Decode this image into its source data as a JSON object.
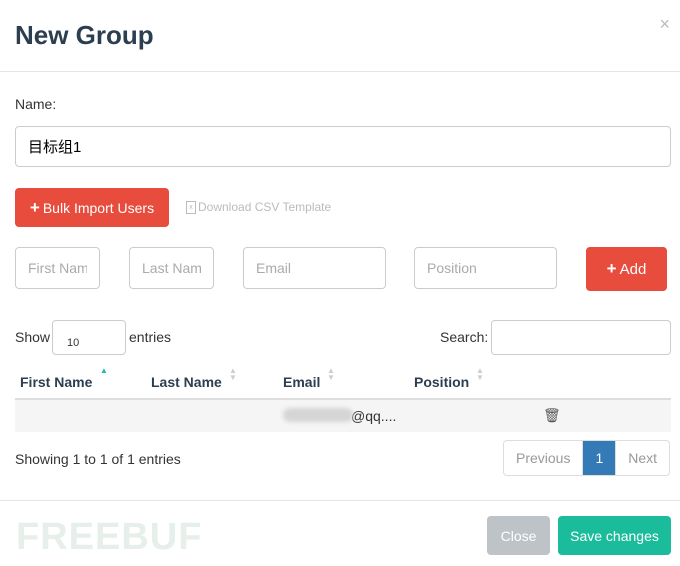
{
  "modal": {
    "title": "New Group",
    "close_icon": "×"
  },
  "form": {
    "name_label": "Name:",
    "name_value": "目标组1",
    "bulk_import": "Bulk Import Users",
    "download_csv": "Download CSV Template",
    "first_name_placeholder": "First Name",
    "last_name_placeholder": "Last Name",
    "email_placeholder": "Email",
    "position_placeholder": "Position",
    "add": "Add"
  },
  "table": {
    "show": "Show",
    "length": "10",
    "entries": "entries",
    "search_label": "Search:",
    "columns": [
      "First Name",
      "Last Name",
      "Email",
      "Position"
    ],
    "sorted_column": "First Name",
    "sort_direction": "ascending",
    "rows": [
      {
        "first_name": "",
        "last_name": "",
        "email_visible": "@qq....",
        "email_redacted": true
      }
    ],
    "info": "Showing 1 to 1 of 1 entries",
    "pagination": {
      "previous": "Previous",
      "current": "1",
      "next": "Next"
    }
  },
  "footer": {
    "close": "Close",
    "save": "Save changes",
    "watermark": "FREEBUF"
  },
  "colors": {
    "danger": "#e74c3c",
    "primary": "#337ab7",
    "success": "#1abc9c",
    "disabled": "#bdc3c7"
  }
}
